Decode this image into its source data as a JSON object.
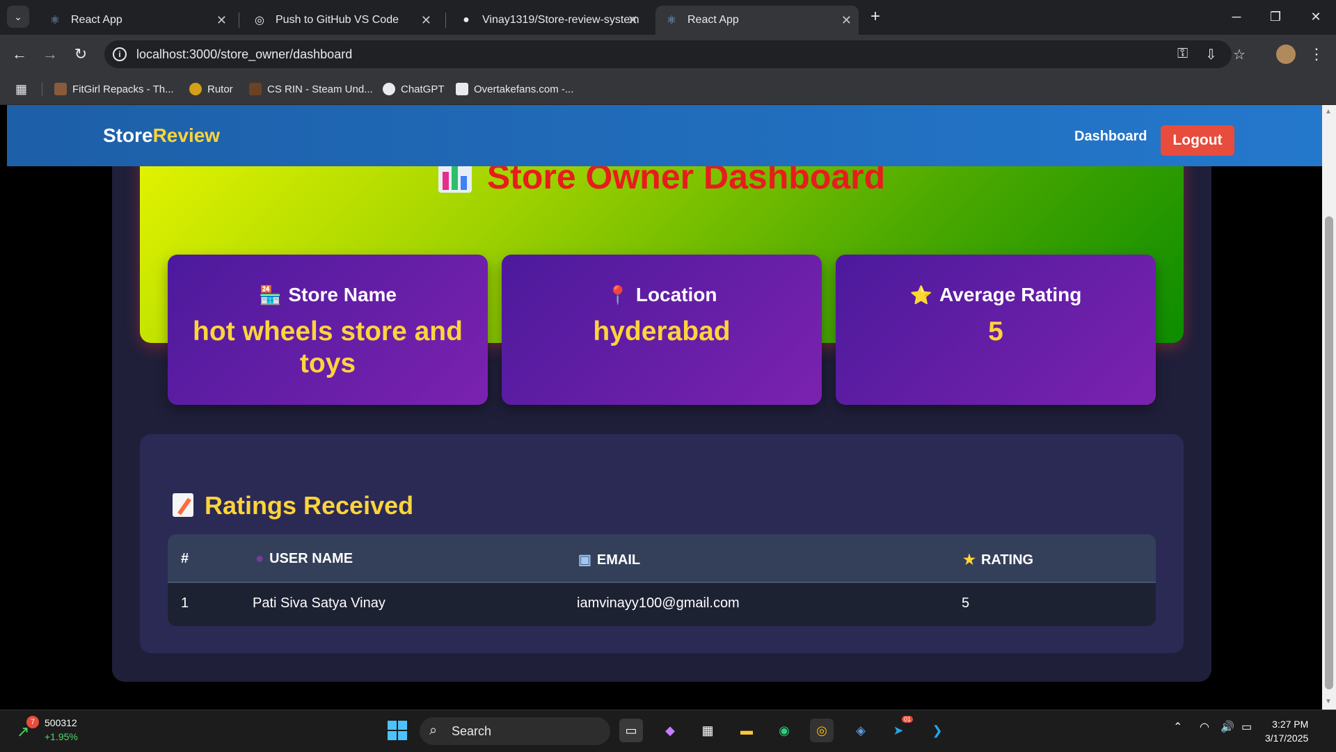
{
  "browser": {
    "tabs": [
      {
        "title": "React App",
        "icon": "react-icon"
      },
      {
        "title": "Push to GitHub VS Code",
        "icon": "chatgpt-icon"
      },
      {
        "title": "Vinay1319/Store-review-system",
        "icon": "github-icon"
      },
      {
        "title": "React App",
        "icon": "react-icon",
        "active": true
      }
    ],
    "url": "localhost:3000/store_owner/dashboard",
    "bookmarks": [
      {
        "label": "FitGirl Repacks - Th...",
        "color": "#8a5a3c"
      },
      {
        "label": "Rutor",
        "color": "#d4a017"
      },
      {
        "label": "CS RIN - Steam Und...",
        "color": "#6b4226"
      },
      {
        "label": "ChatGPT",
        "color": "#e8eaed"
      },
      {
        "label": "Overtakefans.com -...",
        "color": "#e8eaed"
      }
    ]
  },
  "navbar": {
    "brand_main": "Store",
    "brand_accent": "Review",
    "dashboard_link": "Dashboard",
    "logout_label": "Logout"
  },
  "dashboard": {
    "title": "Store Owner Dashboard",
    "cards": [
      {
        "label": "Store Name",
        "emoji": "🏪",
        "value": "hot wheels store and toys"
      },
      {
        "label": "Location",
        "emoji": "📍",
        "value": "hyderabad"
      },
      {
        "label": "Average Rating",
        "emoji": "⭐",
        "value": "5"
      }
    ]
  },
  "ratings": {
    "title": "Ratings Received",
    "headers": {
      "index": "#",
      "user": "USER NAME",
      "email": "EMAIL",
      "rating": "RATING"
    },
    "rows": [
      {
        "index": "1",
        "user": "Pati Siva Satya Vinay",
        "email": "iamvinayy100@gmail.com",
        "rating": "5"
      }
    ]
  },
  "taskbar": {
    "stock_value": "500312",
    "stock_change": "+1.95%",
    "stock_badge": "7",
    "search_label": "Search",
    "time": "3:27 PM",
    "date": "3/17/2025",
    "telegram_badge": "01"
  },
  "colors": {
    "navbar": "#1d5fa8",
    "brand_accent": "#ffd43b",
    "logout": "#e74c3c",
    "card_value": "#ffd43b",
    "title_red": "#e81c1c"
  }
}
